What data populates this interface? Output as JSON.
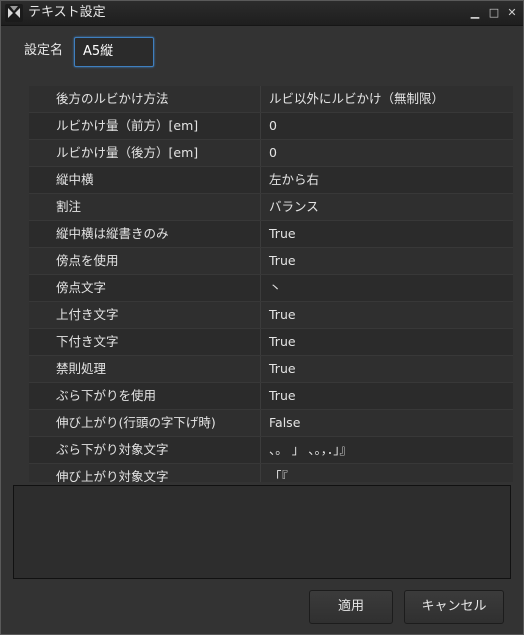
{
  "window": {
    "title": "テキスト設定",
    "minimize_glyph": "▁",
    "maximize_glyph": "□",
    "close_glyph": "✕"
  },
  "form": {
    "name_label": "設定名",
    "name_value": "A5縦"
  },
  "properties": [
    {
      "key": "後方のルビかけ方法",
      "value": "ルビ以外にルビかけ（無制限）"
    },
    {
      "key": "ルビかけ量（前方）[em]",
      "value": "0"
    },
    {
      "key": "ルビかけ量（後方）[em]",
      "value": "0"
    },
    {
      "key": "縦中横",
      "value": "左から右"
    },
    {
      "key": "割注",
      "value": "バランス"
    },
    {
      "key": "縦中横は縦書きのみ",
      "value": "True"
    },
    {
      "key": "傍点を使用",
      "value": "True"
    },
    {
      "key": "傍点文字",
      "value": "丶"
    },
    {
      "key": "上付き文字",
      "value": "True"
    },
    {
      "key": "下付き文字",
      "value": "True"
    },
    {
      "key": "禁則処理",
      "value": "True"
    },
    {
      "key": "ぶら下がりを使用",
      "value": "True"
    },
    {
      "key": "伸び上がり(行頭の字下げ時)",
      "value": "False"
    },
    {
      "key": "ぶら下がり対象文字",
      "value": "、。 」 、。，．」』"
    },
    {
      "key": "伸び上がり対象文字",
      "value": "「『"
    }
  ],
  "buttons": {
    "apply": "適用",
    "cancel": "キャンセル"
  },
  "colors": {
    "background": "#333333",
    "titlebar": "#1e1e1e",
    "focus_border": "#3f7fbf",
    "text": "#e4e4e4"
  }
}
